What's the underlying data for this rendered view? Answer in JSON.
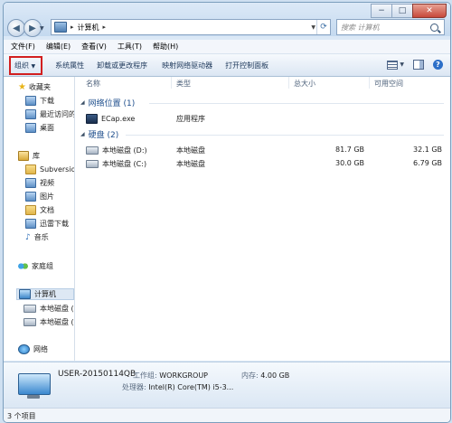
{
  "address": {
    "path": "计算机"
  },
  "search": {
    "placeholder": "搜索 计算机"
  },
  "menu": [
    "文件(F)",
    "编辑(E)",
    "查看(V)",
    "工具(T)",
    "帮助(H)"
  ],
  "toolbar": {
    "organize": "组织",
    "items": [
      "系统属性",
      "卸载或更改程序",
      "映射网络驱动器",
      "打开控制面板"
    ]
  },
  "nav": {
    "favorites": "收藏夹",
    "favorite_items": [
      "下载",
      "最近访问的",
      "桌面"
    ],
    "libraries": "库",
    "library_items": [
      "Subversion",
      "视频",
      "图片",
      "文档",
      "迅雷下载",
      "音乐"
    ],
    "homegroup": "家庭组",
    "computer": "计算机",
    "drives": [
      "本地磁盘 (C",
      "本地磁盘 (D"
    ],
    "network": "网络"
  },
  "columns": {
    "name": "名称",
    "type": "类型",
    "total": "总大小",
    "free": "可用空间"
  },
  "groups": {
    "network": "网络位置 (1)",
    "disks": "硬盘 (2)"
  },
  "network_items": [
    {
      "name": "ECap.exe",
      "type": "应用程序"
    }
  ],
  "disk_items": [
    {
      "name": "本地磁盘 (D:)",
      "type": "本地磁盘",
      "total": "81.7 GB",
      "free": "32.1 GB"
    },
    {
      "name": "本地磁盘 (C:)",
      "type": "本地磁盘",
      "total": "30.0 GB",
      "free": "6.79 GB"
    }
  ],
  "details": {
    "computer_name": "USER-20150114QB",
    "workgroup_label": "工作组:",
    "workgroup": "WORKGROUP",
    "memory_label": "内存:",
    "memory": "4.00 GB",
    "processor_label": "处理器:",
    "processor": "Intel(R) Core(TM) i5-3..."
  },
  "status": {
    "text": "3 个项目"
  }
}
